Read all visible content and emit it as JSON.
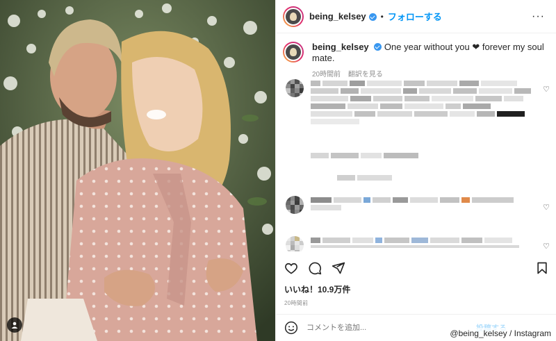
{
  "header": {
    "username": "being_kelsey",
    "separator": "•",
    "follow_label": "フォローする",
    "more_label": "···"
  },
  "caption": {
    "username": "being_kelsey",
    "text": "One year without you ❤ forever my soul mate.",
    "time_ago": "20時間前",
    "translate_label": "翻訳を見る"
  },
  "stats": {
    "likes": "いいね！10.9万件",
    "timestamp": "20時間前"
  },
  "add_comment": {
    "placeholder": "コメントを追加...",
    "post_label": "投稿する"
  },
  "watermark": "@being_kelsey / Instagram",
  "colors": {
    "accent": "#0095f6",
    "verified": "#3897f0",
    "muted": "#8e8e8e",
    "text": "#262626"
  },
  "icons": [
    "heart-icon",
    "comment-icon",
    "share-icon",
    "bookmark-icon",
    "emoji-icon",
    "more-icon",
    "verified-badge-icon",
    "user-tag-icon"
  ]
}
